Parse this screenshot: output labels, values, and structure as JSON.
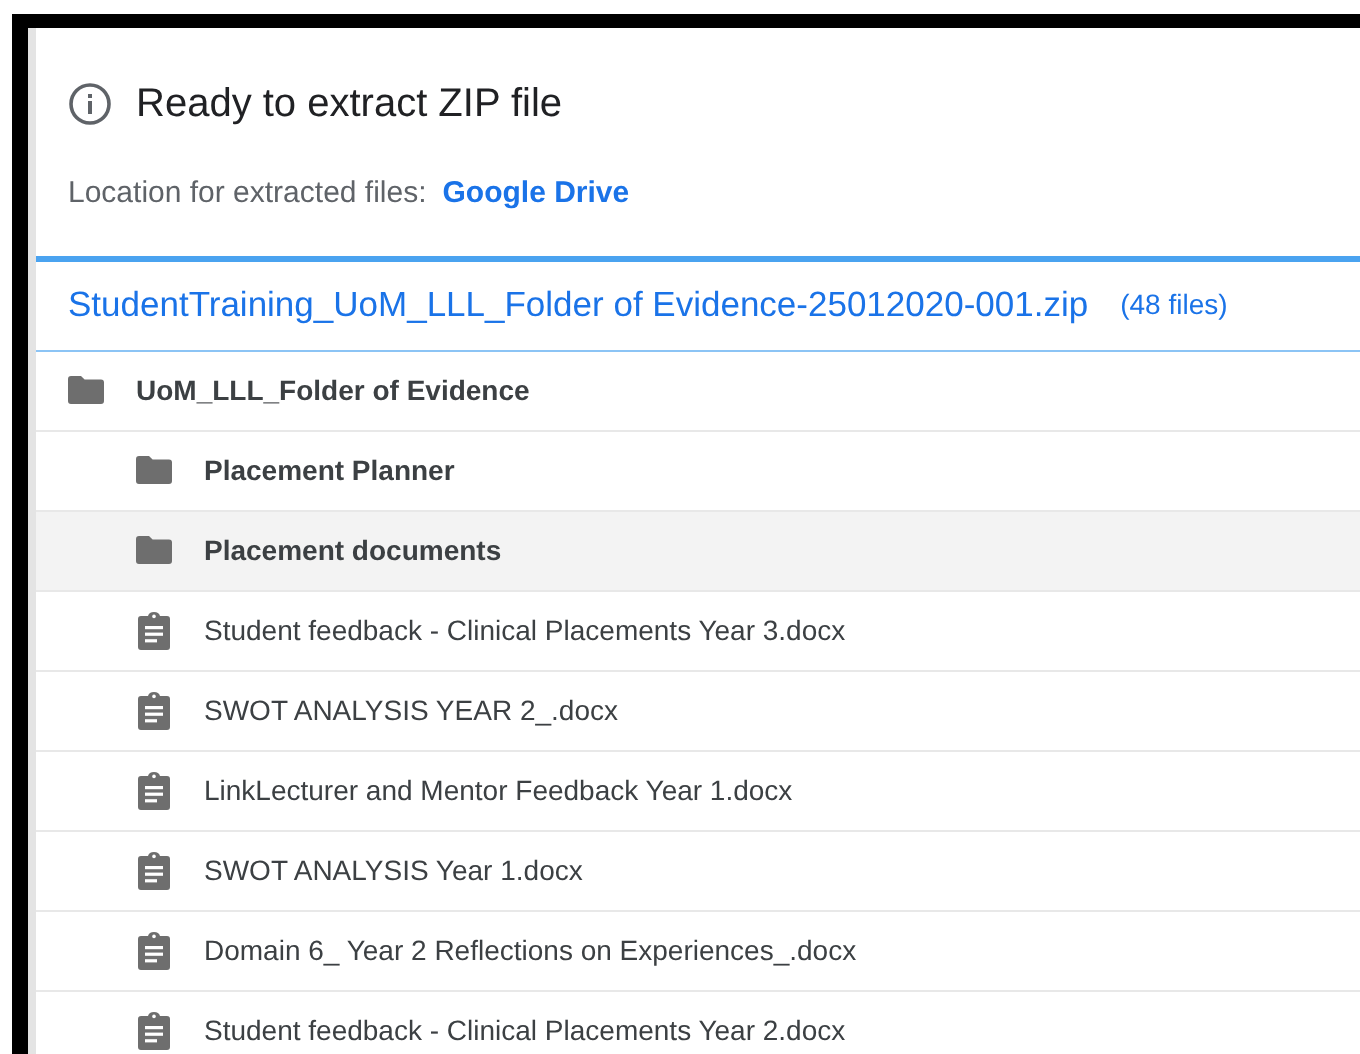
{
  "header": {
    "title": "Ready to extract ZIP file",
    "location_label": "Location for extracted files:",
    "location_link": "Google Drive"
  },
  "archive": {
    "name": "StudentTraining_UoM_LLL_Folder of Evidence-25012020-001.zip",
    "count": "(48 files)"
  },
  "tree": [
    {
      "kind": "folder",
      "name": "UoM_LLL_Folder of Evidence",
      "highlighted": false,
      "children": [
        {
          "kind": "folder",
          "name": "Placement Planner",
          "highlighted": false
        },
        {
          "kind": "folder",
          "name": "Placement documents",
          "highlighted": true
        },
        {
          "kind": "file",
          "name": "Student feedback - Clinical Placements Year 3.docx",
          "highlighted": false
        },
        {
          "kind": "file",
          "name": "SWOT ANALYSIS YEAR 2_.docx",
          "highlighted": false
        },
        {
          "kind": "file",
          "name": "LinkLecturer and Mentor Feedback Year 1.docx",
          "highlighted": false
        },
        {
          "kind": "file",
          "name": "SWOT ANALYSIS Year 1.docx",
          "highlighted": false
        },
        {
          "kind": "file",
          "name": "Domain 6_ Year 2 Reflections on Experiences_.docx",
          "highlighted": false
        },
        {
          "kind": "file",
          "name": "Student feedback - Clinical Placements Year 2.docx",
          "highlighted": false
        }
      ]
    }
  ]
}
